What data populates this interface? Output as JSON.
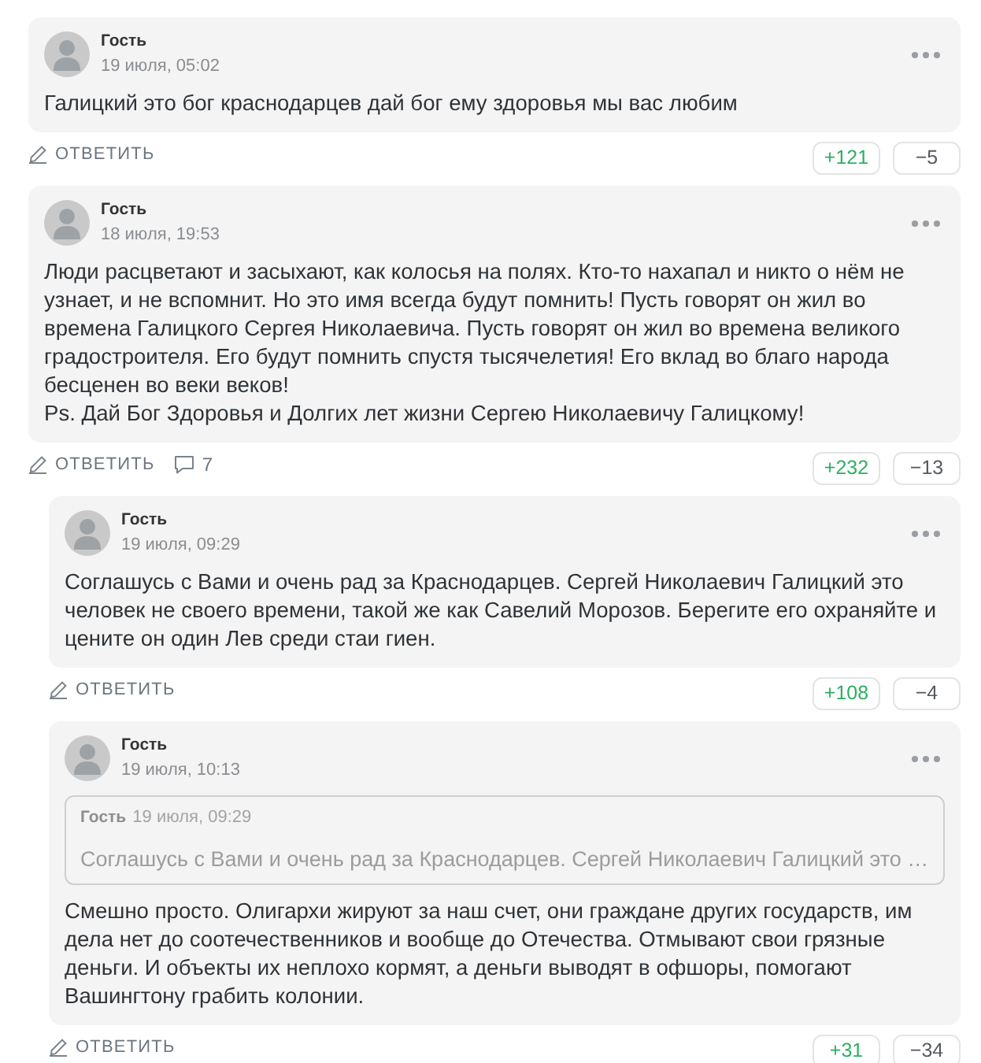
{
  "comments": [
    {
      "author": "Гость",
      "date": "19 июля, 05:02",
      "text": "Галицкий это бог краснодарцев дай бог ему здоровья мы вас любим",
      "reply_label": "ОТВЕТИТЬ",
      "upvotes": "+121",
      "downvotes": "−5"
    },
    {
      "author": "Гость",
      "date": "18 июля, 19:53",
      "text": "Люди расцветают и засыхают, как колосья на полях. Кто-то нахапал и никто о нём не узнает, и не вспомнит. Но это имя всегда будут помнить! Пусть говорят он жил во времена Галицкого Сергея Николаевича. Пусть говорят он жил во времена великого градостроителя. Его будут помнить спустя тысячелетия! Его вклад во благо народа бесценен во веки веков!\nPs. Дай Бог Здоровья и Долгих лет жизни Сергею Николаевичу Галицкому!",
      "reply_label": "ОТВЕТИТЬ",
      "reply_count": "7",
      "upvotes": "+232",
      "downvotes": "−13",
      "children": [
        {
          "author": "Гость",
          "date": "19 июля, 09:29",
          "text": "Соглашусь с Вами и очень рад за Краснодарцев. Сергей Николаевич Галицкий это человек не своего времени, такой же как Савелий Морозов. Берегите его охраняйте и цените он один Лев среди стаи гиен.",
          "reply_label": "ОТВЕТИТЬ",
          "upvotes": "+108",
          "downvotes": "−4"
        },
        {
          "author": "Гость",
          "date": "19 июля, 10:13",
          "quote": {
            "author": "Гость",
            "date": "19 июля, 09:29",
            "text": "Соглашусь с Вами и очень рад за Краснодарцев. Сергей Николаевич Галицкий это …"
          },
          "text": "Смешно просто. Олигархи жируют за наш счет, они граждане других государств, им дела нет до соотечественников и вообще до Отечества. Отмывают свои грязные деньги. И объекты их неплохо кормят, а деньги выводят в офшоры, помогают Вашингтону грабить колонии.",
          "reply_label": "ОТВЕТИТЬ",
          "upvotes": "+31",
          "downvotes": "−34"
        }
      ]
    }
  ]
}
